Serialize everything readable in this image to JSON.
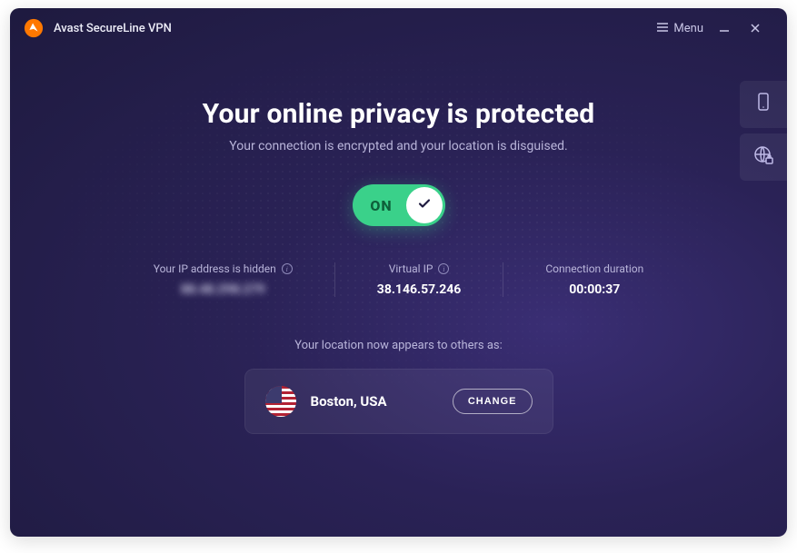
{
  "titlebar": {
    "app_name": "Avast SecureLine VPN",
    "menu_label": "Menu"
  },
  "main": {
    "heading": "Your online privacy is protected",
    "subheading": "Your connection is encrypted and your location is disguised.",
    "toggle_label": "ON"
  },
  "stats": {
    "real_ip": {
      "label": "Your IP address is hidden",
      "value": "88.48.298.279"
    },
    "virtual_ip": {
      "label": "Virtual IP",
      "value": "38.146.57.246"
    },
    "duration": {
      "label": "Connection duration",
      "value": "00:00:37"
    }
  },
  "location": {
    "caption": "Your location now appears to others as:",
    "name": "Boston, USA",
    "change_label": "CHANGE",
    "flag": "us"
  },
  "side_tools": {
    "device_icon": "phone-icon",
    "globe_icon": "globe-lock-icon"
  }
}
